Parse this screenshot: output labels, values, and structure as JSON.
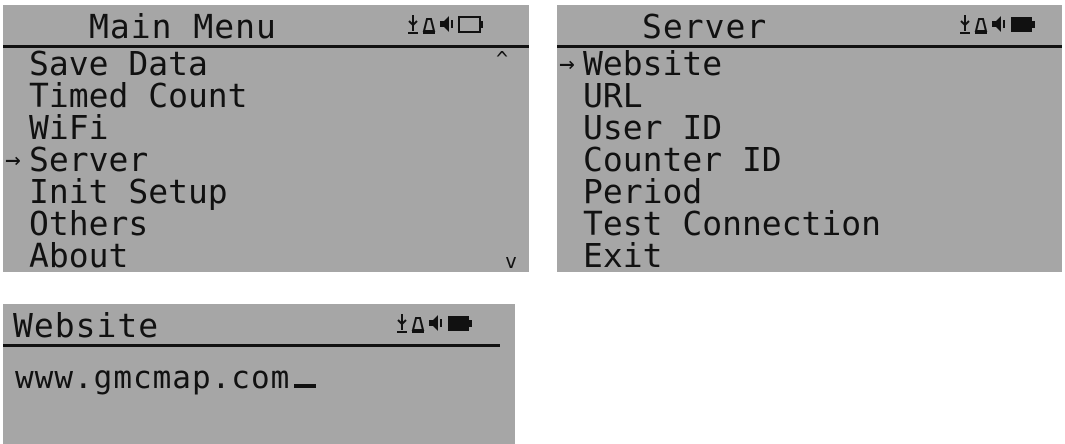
{
  "screens": {
    "main_menu": {
      "title": "Main Menu",
      "items": [
        {
          "label": "Save Data",
          "selected": false
        },
        {
          "label": "Timed Count",
          "selected": false
        },
        {
          "label": "WiFi",
          "selected": false
        },
        {
          "label": "Server",
          "selected": true
        },
        {
          "label": "Init Setup",
          "selected": false
        },
        {
          "label": "Others",
          "selected": false
        },
        {
          "label": "About",
          "selected": false
        }
      ],
      "scroll_up_glyph": "^",
      "scroll_down_glyph": "v",
      "battery": "empty"
    },
    "server": {
      "title": "Server",
      "items": [
        {
          "label": "Website",
          "selected": true
        },
        {
          "label": "URL",
          "selected": false
        },
        {
          "label": "User ID",
          "selected": false
        },
        {
          "label": "Counter ID",
          "selected": false
        },
        {
          "label": "Period",
          "selected": false
        },
        {
          "label": "Test Connection",
          "selected": false
        },
        {
          "label": "Exit",
          "selected": false
        }
      ],
      "battery": "full"
    },
    "website": {
      "title": "Website",
      "value": "www.gmcmap.com",
      "battery": "full"
    }
  },
  "selection_arrow": "→",
  "status_icons": [
    "usb-icon",
    "alarm-icon",
    "speaker-icon",
    "battery-icon"
  ],
  "colors": {
    "lcd_background": "#a6a6a6",
    "lcd_text": "#111111"
  }
}
